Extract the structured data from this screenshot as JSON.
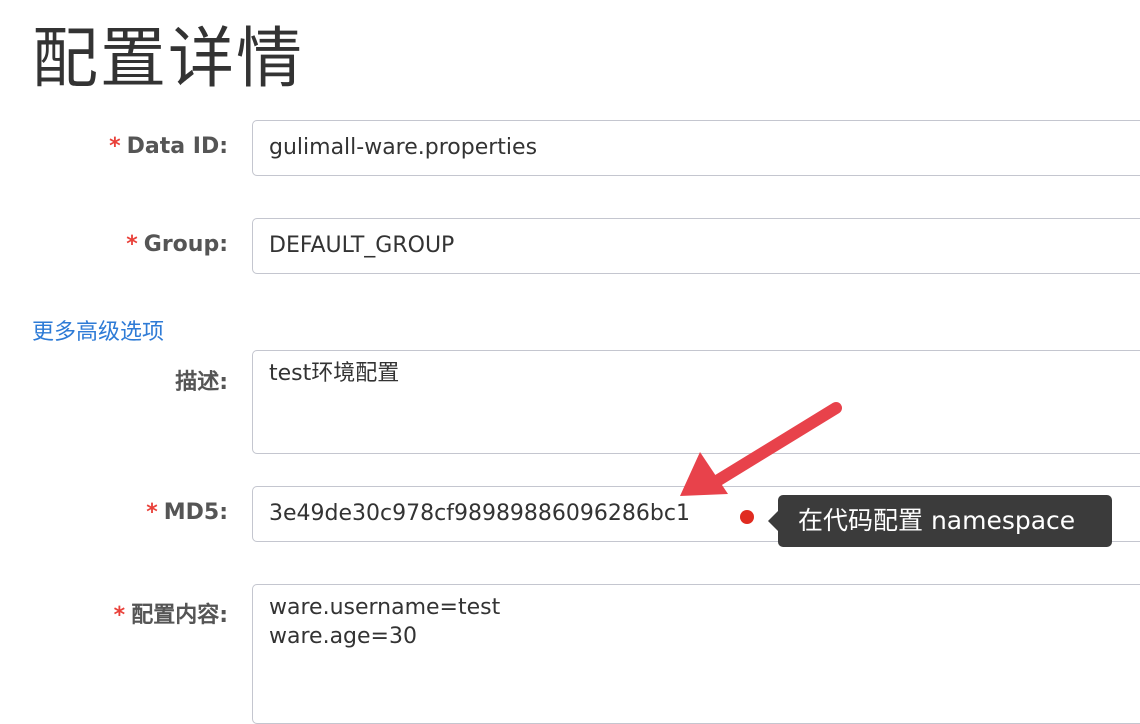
{
  "page": {
    "title": "配置详情"
  },
  "form": {
    "required_mark": "*",
    "data_id": {
      "label": "Data ID:",
      "value": "gulimall-ware.properties"
    },
    "group": {
      "label": "Group:",
      "value": "DEFAULT_GROUP"
    },
    "advanced_link": "更多高级选项",
    "description": {
      "label": "描述:",
      "value": "test环境配置"
    },
    "md5": {
      "label": "MD5:",
      "value": "3e49de30c978cf98989886096286bc1"
    },
    "content": {
      "label": "配置内容:",
      "value": "ware.username=test\nware.age=30"
    }
  },
  "annotation": {
    "tooltip_text": "在代码配置 namespace",
    "arrow_color": "#e8424b",
    "dot_color": "#e02b20"
  },
  "colors": {
    "required": "#e9413a",
    "link": "#2e7bd6",
    "tooltip_bg": "#3b3b3b"
  }
}
